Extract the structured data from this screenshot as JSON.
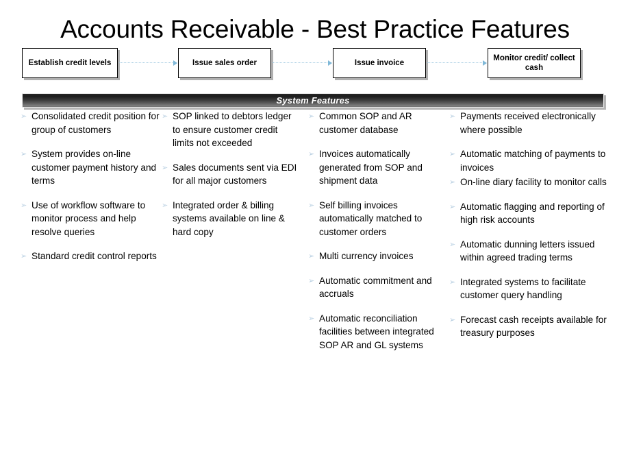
{
  "slide": {
    "title": "Accounts Receivable - Best Practice Features"
  },
  "process_flow": {
    "bullet_glyph": "➢",
    "arrow_color": "#9fc8e0",
    "steps": [
      {
        "label": "Establish credit levels"
      },
      {
        "label": "Issue sales order"
      },
      {
        "label": "Issue invoice"
      },
      {
        "label": "Monitor credit/ collect cash"
      }
    ]
  },
  "features": {
    "banner_label": "System Features",
    "banner_text_color": "#ffffff",
    "columns": [
      {
        "items": [
          {
            "text": "Consolidated credit position for group of customers",
            "tight": false
          },
          {
            "text": "System provides on-line customer payment history and terms",
            "tight": false
          },
          {
            "text": "Use of workflow software to monitor process and help resolve queries",
            "tight": false
          },
          {
            "text": "Standard credit control reports",
            "tight": false
          }
        ]
      },
      {
        "items": [
          {
            "text": "SOP linked to debtors ledger to ensure customer credit limits not exceeded",
            "tight": false
          },
          {
            "text": "Sales documents sent via EDI for all major customers",
            "tight": false
          },
          {
            "text": "Integrated order & billing systems available on line & hard copy",
            "tight": false
          }
        ]
      },
      {
        "items": [
          {
            "text": "Common SOP and AR customer database",
            "tight": false
          },
          {
            "text": "Invoices automatically generated from SOP and shipment data",
            "tight": false
          },
          {
            "text": "Self billing invoices automatically matched to customer orders",
            "tight": false
          },
          {
            "text": "Multi currency invoices",
            "tight": false
          },
          {
            "text": "Automatic commitment and accruals",
            "tight": false
          },
          {
            "text": "Automatic reconciliation facilities between integrated SOP AR and GL systems",
            "tight": false
          }
        ]
      },
      {
        "items": [
          {
            "text": "Payments received electronically where possible",
            "tight": false
          },
          {
            "text": "Automatic matching of payments to invoices",
            "tight": true
          },
          {
            "text": "On-line diary facility to monitor calls",
            "tight": false
          },
          {
            "text": "Automatic flagging and reporting of high risk accounts",
            "tight": false
          },
          {
            "text": "Automatic dunning letters issued within agreed trading terms",
            "tight": false
          },
          {
            "text": "Integrated systems to facilitate customer query handling",
            "tight": false
          },
          {
            "text": "Forecast cash receipts available for treasury purposes",
            "tight": false
          }
        ]
      }
    ]
  }
}
